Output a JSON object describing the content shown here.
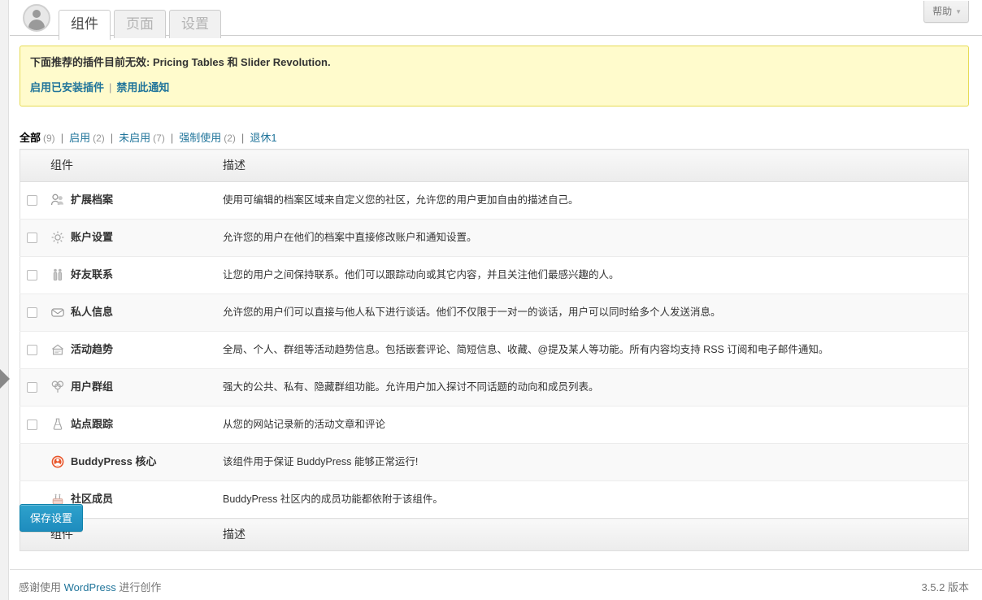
{
  "window": {
    "avatar_icon": "user-avatar-icon"
  },
  "tabs": [
    {
      "label": "组件",
      "active": true
    },
    {
      "label": "页面",
      "active": false
    },
    {
      "label": "设置",
      "active": false
    }
  ],
  "help": {
    "label": "帮助",
    "caret": "▼"
  },
  "notice": {
    "message": "下面推荐的插件目前无效: Pricing Tables 和 Slider Revolution.",
    "activate_link": "启用已安装插件",
    "separator": "|",
    "dismiss_link": "禁用此通知"
  },
  "filters": [
    {
      "label": "全部",
      "count": "(9)",
      "current": true
    },
    {
      "label": "启用",
      "count": "(2)",
      "current": false
    },
    {
      "label": "未启用",
      "count": "(7)",
      "current": false
    },
    {
      "label": "强制使用",
      "count": "(2)",
      "current": false
    },
    {
      "label": "退休",
      "count": "1",
      "current": false
    }
  ],
  "table": {
    "columns": {
      "name": "组件",
      "description": "描述"
    },
    "rows": [
      {
        "checkbox": true,
        "icon": "extended-profiles-icon",
        "name": "扩展档案",
        "description": "使用可编辑的档案区域来自定义您的社区，允许您的用户更加自由的描述自己。"
      },
      {
        "checkbox": true,
        "icon": "account-settings-gear-icon",
        "name": "账户设置",
        "description": "允许您的用户在他们的档案中直接修改账户和通知设置。"
      },
      {
        "checkbox": true,
        "icon": "friend-connections-icon",
        "name": "好友联系",
        "description": "让您的用户之间保持联系。他们可以跟踪动向或其它内容，并且关注他们最感兴趣的人。"
      },
      {
        "checkbox": true,
        "icon": "private-messaging-envelope-icon",
        "name": "私人信息",
        "description": "允许您的用户们可以直接与他人私下进行谈话。他们不仅限于一对一的谈话，用户可以同时给多个人发送消息。"
      },
      {
        "checkbox": true,
        "icon": "activity-streams-icon",
        "name": "活动趋势",
        "description": "全局、个人、群组等活动趋势信息。包括嵌套评论、简短信息、收藏、@提及某人等功能。所有内容均支持 RSS 订阅和电子邮件通知。"
      },
      {
        "checkbox": true,
        "icon": "user-groups-balloon-icon",
        "name": "用户群组",
        "description": "强大的公共、私有、隐藏群组功能。允许用户加入探讨不同话题的动向和成员列表。"
      },
      {
        "checkbox": true,
        "icon": "site-tracking-icon",
        "name": "站点跟踪",
        "description": "从您的网站记录新的活动文章和评论"
      },
      {
        "checkbox": false,
        "icon": "buddypress-core-icon",
        "name": "BuddyPress 核心",
        "description": "该组件用于保证 BuddyPress 能够正常运行!"
      },
      {
        "checkbox": false,
        "icon": "community-members-icon",
        "name": "社区成员",
        "description": "BuddyPress 社区内的成员功能都依附于该组件。"
      }
    ]
  },
  "save_button": {
    "label": "保存设置"
  },
  "footer": {
    "thanks_prefix": "感谢使用",
    "wordpress_link": "WordPress",
    "thanks_suffix": "进行创作",
    "version": "3.5.2 版本"
  },
  "colors": {
    "accent_blue": "#21759b",
    "button_blue": "#2ea2cc",
    "notice_bg": "#fffbcc",
    "notice_border": "#e6db55",
    "row_alt": "#f9f9f9"
  }
}
